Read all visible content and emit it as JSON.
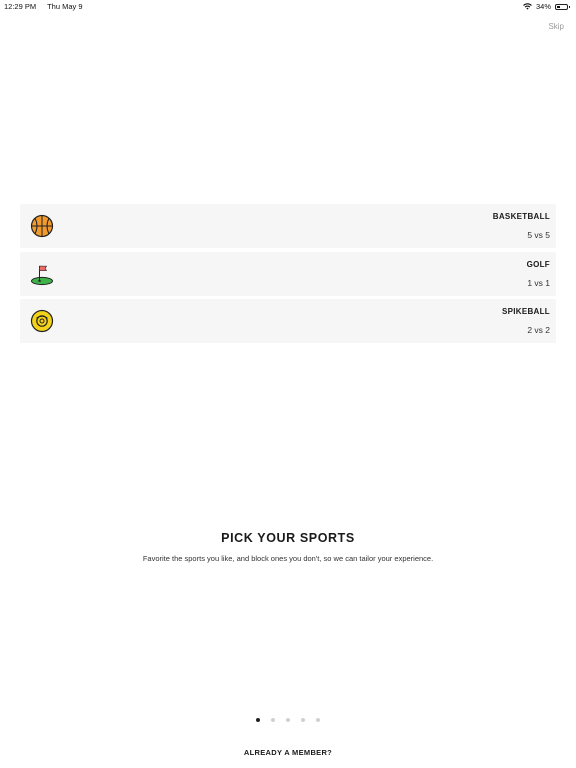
{
  "status_bar": {
    "time": "12:29 PM",
    "date": "Thu May 9",
    "battery_text": "34%",
    "battery_level": 0.34
  },
  "header": {
    "skip_label": "Skip"
  },
  "sports": [
    {
      "name": "BASKETBALL",
      "format": "5 vs 5",
      "icon": "basketball-icon"
    },
    {
      "name": "GOLF",
      "format": "1 vs 1",
      "icon": "golf-flag-icon"
    },
    {
      "name": "SPIKEBALL",
      "format": "2 vs 2",
      "icon": "spikeball-icon"
    }
  ],
  "onboarding": {
    "title": "PICK YOUR SPORTS",
    "description": "Favorite the sports you like, and block ones you don't, so we can tailor your experience."
  },
  "pager": {
    "total": 5,
    "active_index": 0
  },
  "footer": {
    "member_label": "ALREADY A MEMBER?"
  },
  "colors": {
    "basketball": "#f29a2e",
    "golf_green": "#3db34a",
    "flag": "#f06a6a",
    "spikeball": "#f5d21a"
  }
}
